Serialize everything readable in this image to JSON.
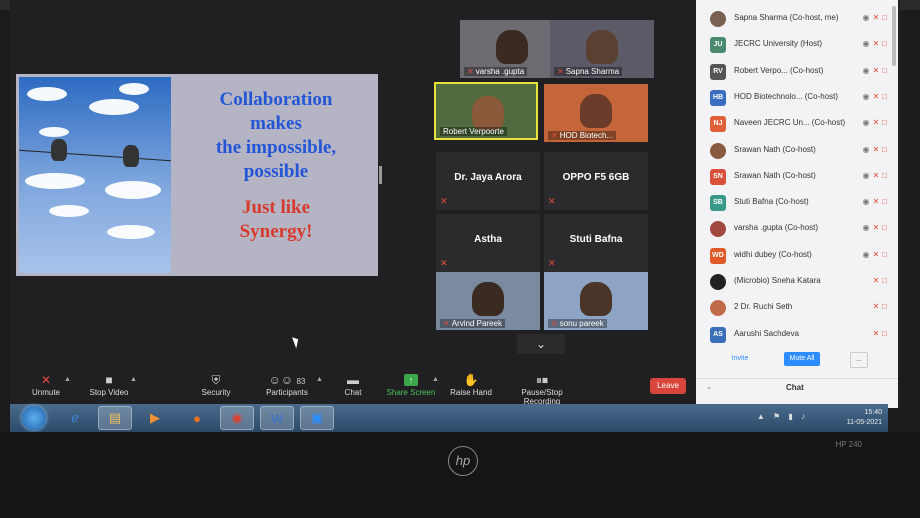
{
  "slide": {
    "line1": "Collaboration",
    "line2": "makes",
    "line3": "the impossible,",
    "line4": "possible",
    "line5": "Just like",
    "line6": "Synergy!"
  },
  "tiles": [
    {
      "name": "varsha .gupta",
      "kind": "video",
      "color": "#6e6a72"
    },
    {
      "name": "Sapna Sharma",
      "kind": "video",
      "color": "#5c5a66"
    },
    {
      "name": "Robert Verpoorte",
      "kind": "video",
      "color": "#4f6a3e",
      "active": true
    },
    {
      "name": "HOD Biotech...",
      "kind": "video",
      "color": "#c5663a"
    },
    {
      "name": "Dr. Jaya Arora",
      "kind": "name"
    },
    {
      "name": "OPPO F5 6GB",
      "kind": "name"
    },
    {
      "name": "Astha",
      "kind": "name"
    },
    {
      "name": "Stuti Bafna",
      "kind": "name"
    },
    {
      "name": "Arvind Pareek",
      "kind": "video",
      "color": "#7a8aa0"
    },
    {
      "name": "sonu pareek",
      "kind": "video",
      "color": "#8ea4c4"
    }
  ],
  "toolbar": {
    "unmute": "Unmute",
    "stop_video": "Stop Video",
    "security": "Security",
    "participants": "Participants",
    "participants_count": "83",
    "chat": "Chat",
    "share_screen": "Share Screen",
    "raise_hand": "Raise Hand",
    "record": "Pause/Stop Recording",
    "leave": "Leave"
  },
  "participants": [
    {
      "initials": "",
      "name": "Sapna Sharma (Co-host, me)",
      "color": "#7a6050"
    },
    {
      "initials": "JU",
      "name": "JECRC University (Host)",
      "color": "#4a8a6e"
    },
    {
      "initials": "RV",
      "name": "Robert Verpo... (Co-host)",
      "color": "#555555"
    },
    {
      "initials": "HB",
      "name": "HOD Biotechnolo... (Co-host)",
      "color": "#3a6fc0"
    },
    {
      "initials": "NJ",
      "name": "Naveen JECRC Un... (Co-host)",
      "color": "#e0603a"
    },
    {
      "initials": "",
      "name": "Srawan Nath (Co-host)",
      "color": "#8a5a40"
    },
    {
      "initials": "SN",
      "name": "Srawan Nath (Co-host)",
      "color": "#d9503a"
    },
    {
      "initials": "SB",
      "name": "Stuti Bafna (Co-host)",
      "color": "#3a9a8a"
    },
    {
      "initials": "",
      "name": "varsha .gupta (Co-host)",
      "color": "#a04a40"
    },
    {
      "initials": "WD",
      "name": "widhi dubey (Co-host)",
      "color": "#e05a2a"
    },
    {
      "initials": "",
      "name": "(Microbio) Sneha Katara",
      "color": "#222222"
    },
    {
      "initials": "",
      "name": "2 Dr. Ruchi Seth",
      "color": "#c06a4a"
    },
    {
      "initials": "AS",
      "name": "Aarushi Sachdeva",
      "color": "#3a70b8"
    }
  ],
  "panel": {
    "invite": "Invite",
    "mute_all": "Mute All",
    "more": "...",
    "chat": "Chat"
  },
  "clock": {
    "time": "15:40",
    "date": "11-05-2021"
  },
  "laptop": {
    "model": "HP 240",
    "logo": "hp"
  }
}
